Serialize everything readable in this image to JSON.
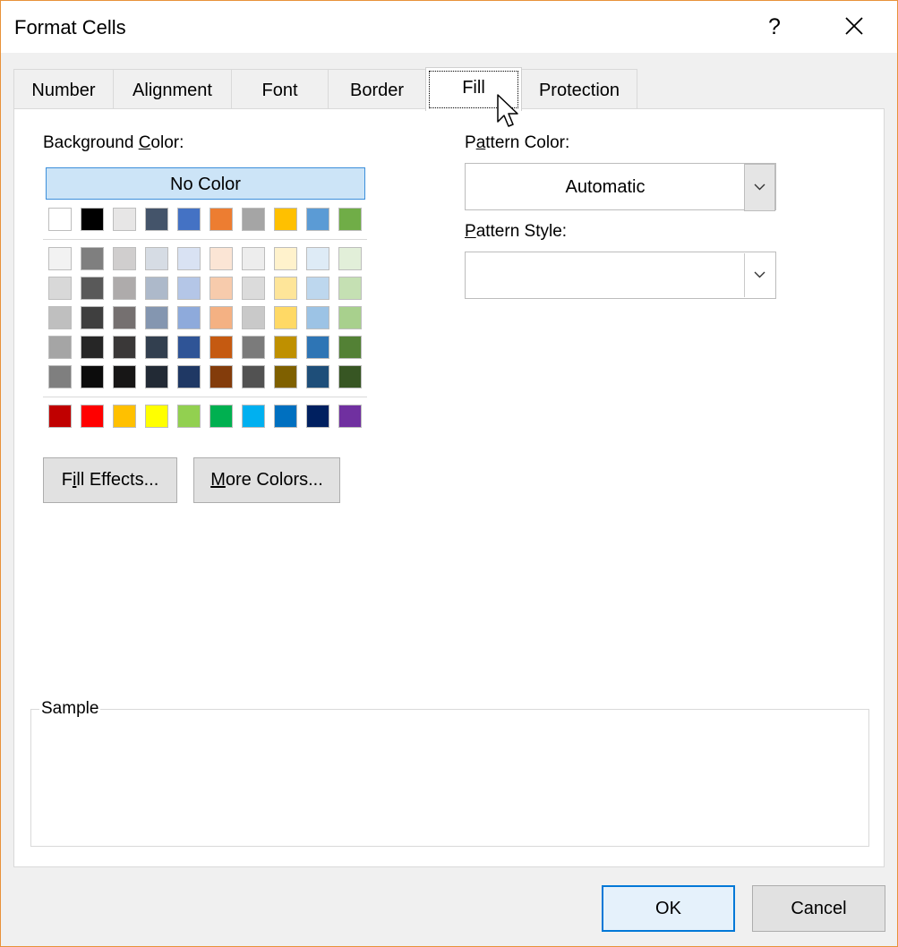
{
  "dialog": {
    "title": "Format Cells",
    "help_label": "?"
  },
  "tabs": [
    {
      "label": "Number"
    },
    {
      "label": "Alignment"
    },
    {
      "label": "Font"
    },
    {
      "label": "Border"
    },
    {
      "label": "Fill",
      "selected": true
    },
    {
      "label": "Protection"
    }
  ],
  "background": {
    "label_pre": "Background ",
    "label_ul": "C",
    "label_post": "olor:",
    "no_color_label": "No Color",
    "theme_row": [
      "#ffffff",
      "#000000",
      "#e7e6e6",
      "#44546a",
      "#4472c4",
      "#ed7d31",
      "#a5a5a5",
      "#ffc000",
      "#5b9bd5",
      "#70ad47"
    ],
    "tints": [
      [
        "#f2f2f2",
        "#7f7f7f",
        "#d0cece",
        "#d6dce4",
        "#d9e2f3",
        "#fbe5d5",
        "#ededed",
        "#fff2cc",
        "#deebf6",
        "#e2efd9"
      ],
      [
        "#d8d8d8",
        "#595959",
        "#aeabab",
        "#adb9ca",
        "#b4c6e7",
        "#f7cbac",
        "#dbdbdb",
        "#fee599",
        "#bdd7ee",
        "#c5e0b3"
      ],
      [
        "#bfbfbf",
        "#3f3f3f",
        "#757070",
        "#8496b0",
        "#8eaadb",
        "#f4b183",
        "#c9c9c9",
        "#ffd965",
        "#9cc3e5",
        "#a8d08d"
      ],
      [
        "#a5a5a5",
        "#262626",
        "#3a3838",
        "#323f4f",
        "#2f5496",
        "#c55a11",
        "#7b7b7b",
        "#bf9000",
        "#2e75b5",
        "#538135"
      ],
      [
        "#7f7f7f",
        "#0c0c0c",
        "#171616",
        "#222a35",
        "#1f3864",
        "#833c0b",
        "#525252",
        "#7f6000",
        "#1e4e79",
        "#375623"
      ]
    ],
    "standard_row": [
      "#c00000",
      "#ff0000",
      "#ffc000",
      "#ffff00",
      "#92d050",
      "#00b050",
      "#00b0f0",
      "#0070c0",
      "#002060",
      "#7030a0"
    ]
  },
  "buttons": {
    "fill_effects": {
      "pre": "F",
      "ul": "i",
      "post": "ll Effects..."
    },
    "more_colors": {
      "pre": "",
      "ul": "M",
      "post": "ore Colors..."
    }
  },
  "pattern_color": {
    "label_pre": "P",
    "label_ul": "a",
    "label_post": "ttern Color:",
    "value": "Automatic"
  },
  "pattern_style": {
    "label_pre": "",
    "label_ul": "P",
    "label_post": "attern Style:",
    "value": ""
  },
  "sample": {
    "label": "Sample"
  },
  "footer": {
    "ok_label": "OK",
    "cancel_label": "Cancel"
  }
}
